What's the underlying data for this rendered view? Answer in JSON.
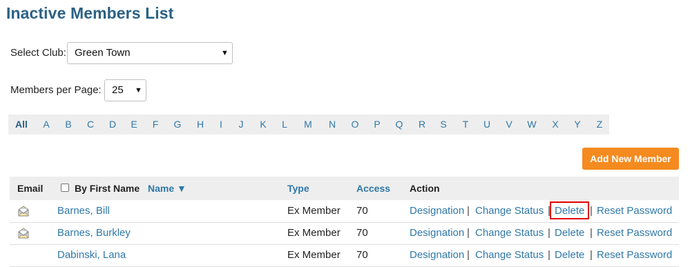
{
  "page": {
    "title": "Inactive Members List"
  },
  "filters": {
    "club_label": "Select Club:",
    "club_value": "Green Town",
    "per_page_label": "Members per Page:",
    "per_page_value": "25"
  },
  "alphabet": [
    "All",
    "A",
    "B",
    "C",
    "D",
    "E",
    "F",
    "G",
    "H",
    "I",
    "J",
    "K",
    "L",
    "M",
    "N",
    "O",
    "P",
    "Q",
    "R",
    "S",
    "T",
    "U",
    "V",
    "W",
    "X",
    "Y",
    "Z"
  ],
  "add_button": "Add New Member",
  "table": {
    "headers": {
      "email": "Email",
      "by_first_name": "By First Name",
      "name": "Name ▼",
      "type": "Type",
      "access": "Access",
      "action": "Action"
    },
    "action_labels": {
      "designation": "Designation",
      "change_status": "Change Status",
      "delete": "Delete",
      "reset_password": "Reset Password"
    },
    "rows": [
      {
        "name": "Barnes, Bill",
        "type": "Ex Member",
        "access": "70",
        "email_icon": "envelope-icon"
      },
      {
        "name": "Barnes, Burkley",
        "type": "Ex Member",
        "access": "70",
        "email_icon": "envelope-icon"
      },
      {
        "name": "Dabinski, Lana",
        "type": "Ex Member",
        "access": "70",
        "email_icon": ""
      }
    ]
  },
  "colors": {
    "accent": "#2b6187",
    "link": "#2f78a8",
    "button": "#f58a1f",
    "highlight": "#e00000"
  }
}
